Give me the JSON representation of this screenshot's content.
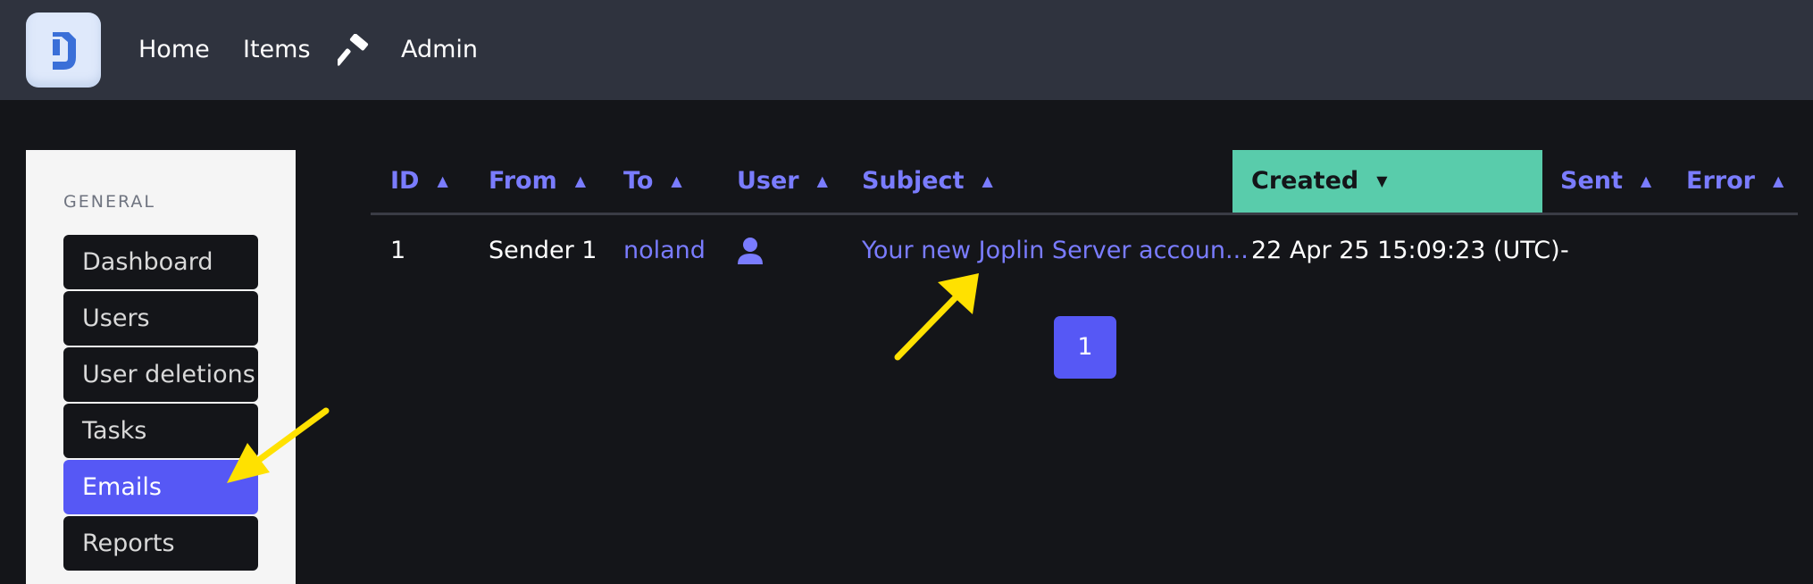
{
  "nav": {
    "logo_icon": "joplin-logo-icon",
    "home": "Home",
    "items": "Items",
    "admin_icon": "hammer-icon",
    "admin": "Admin"
  },
  "sidebar": {
    "heading": "GENERAL",
    "items": [
      {
        "label": "Dashboard",
        "active": false
      },
      {
        "label": "Users",
        "active": false
      },
      {
        "label": "User deletions",
        "active": false
      },
      {
        "label": "Tasks",
        "active": false
      },
      {
        "label": "Emails",
        "active": true
      },
      {
        "label": "Reports",
        "active": false
      }
    ]
  },
  "table": {
    "columns": [
      "ID",
      "From",
      "To",
      "User",
      "Subject",
      "Created",
      "Sent",
      "Error"
    ],
    "sorted_column": "Created",
    "rows": [
      {
        "id": "1",
        "from": "Sender 1",
        "to": "noland",
        "user_icon": "user-icon",
        "subject": "Your new Joplin Server accoun...",
        "created": "22 Apr 25 15:09:23 (UTC)",
        "sent": "-",
        "error": ""
      }
    ]
  },
  "pagination": {
    "current": "1"
  },
  "colors": {
    "accent": "#5658f5",
    "link": "#7a7cff",
    "sorted_header": "#59ccab",
    "annotation_arrow": "#ffe100"
  }
}
